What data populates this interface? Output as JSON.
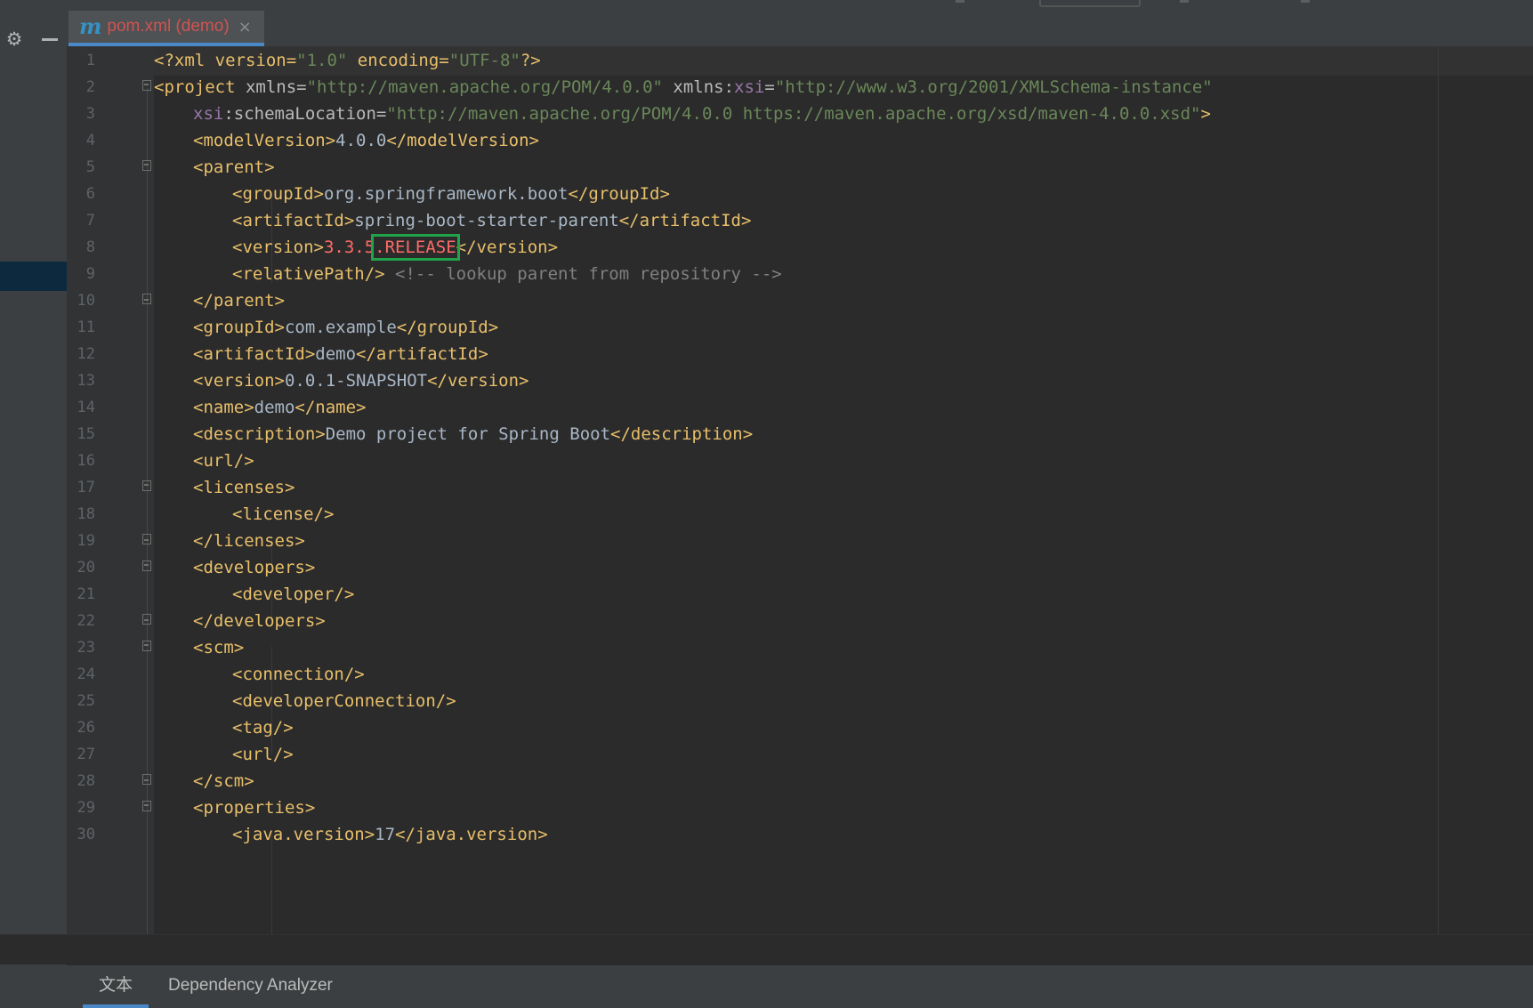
{
  "editor": {
    "tab": {
      "icon": "maven-icon",
      "icon_glyph": "m",
      "title": "pom.xml (demo)",
      "close_glyph": "×"
    },
    "line_numbers": [
      "1",
      "2",
      "3",
      "4",
      "5",
      "6",
      "7",
      "8",
      "9",
      "10",
      "11",
      "12",
      "13",
      "14",
      "15",
      "16",
      "17",
      "18",
      "19",
      "20",
      "21",
      "22",
      "23",
      "24",
      "25",
      "26",
      "27",
      "28",
      "29",
      "30"
    ],
    "code": {
      "l1": [
        "<?xml version=",
        "\"1.0\"",
        " encoding=",
        "\"UTF-8\"",
        "?>"
      ],
      "l2": [
        "<project ",
        "xmlns=",
        "\"http://maven.apache.org/POM/4.0.0\"",
        " xmlns:",
        "xsi",
        "=",
        "\"http://www.w3.org/2001/XMLSchema-instance\""
      ],
      "l3": [
        "xsi",
        ":schemaLocation=",
        "\"http://maven.apache.org/POM/4.0.0 https://maven.apache.org/xsd/maven-4.0.0.xsd\"",
        ">"
      ],
      "l4": [
        "<modelVersion>",
        "4.0.0",
        "</modelVersion>"
      ],
      "l5": [
        "<parent>"
      ],
      "l6": [
        "<groupId>",
        "org.springframework.boot",
        "</groupId>"
      ],
      "l7": [
        "<artifactId>",
        "spring-boot-starter-parent",
        "</artifactId>"
      ],
      "l8": [
        "<version>",
        "3.3.5",
        ".RELEASE",
        "</version>"
      ],
      "l9": [
        "<relativePath/>",
        " <!-- lookup parent from repository -->"
      ],
      "l10": [
        "</parent>"
      ],
      "l11": [
        "<groupId>",
        "com.example",
        "</groupId>"
      ],
      "l12": [
        "<artifactId>",
        "demo",
        "</artifactId>"
      ],
      "l13": [
        "<version>",
        "0.0.1-SNAPSHOT",
        "</version>"
      ],
      "l14": [
        "<name>",
        "demo",
        "</name>"
      ],
      "l15": [
        "<description>",
        "Demo project for Spring Boot",
        "</description>"
      ],
      "l16": [
        "<url/>"
      ],
      "l17": [
        "<licenses>"
      ],
      "l18": [
        "<license/>"
      ],
      "l19": [
        "</licenses>"
      ],
      "l20": [
        "<developers>"
      ],
      "l21": [
        "<developer/>"
      ],
      "l22": [
        "</developers>"
      ],
      "l23": [
        "<scm>"
      ],
      "l24": [
        "<connection/>"
      ],
      "l25": [
        "<developerConnection/>"
      ],
      "l26": [
        "<tag/>"
      ],
      "l27": [
        "<url/>"
      ],
      "l28": [
        "</scm>"
      ],
      "l29": [
        "<properties>"
      ],
      "l30": [
        "<java.version>",
        "17",
        "</java.version>"
      ]
    },
    "error_token": "3.3.5.RELEASE"
  },
  "bottom_tabs": {
    "text": "文本",
    "dependency": "Dependency Analyzer"
  },
  "colors": {
    "tag": "#e8bf6a",
    "attribute": "#bababa",
    "string": "#6a8759",
    "namespace": "#9876aa",
    "comment": "#808080",
    "error": "#ff6b68",
    "accent": "#4a88c7",
    "highlight_box": "#20a44a"
  }
}
